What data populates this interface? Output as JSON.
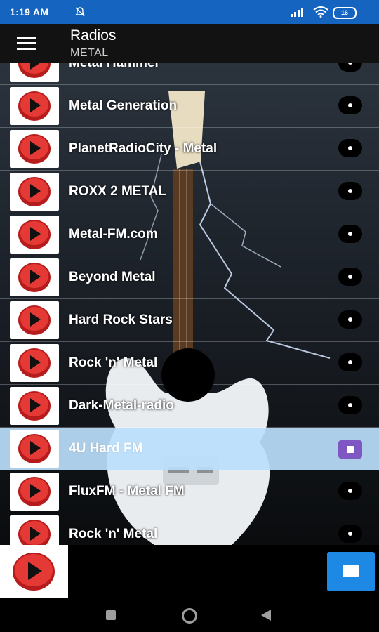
{
  "status_bar": {
    "time": "1:19 AM",
    "battery": "16"
  },
  "app_bar": {
    "title": "Radios",
    "subtitle": "METAL"
  },
  "stations": [
    {
      "name": "Metal Hammer",
      "action": "more"
    },
    {
      "name": "Metal Generation",
      "action": "more"
    },
    {
      "name": "PlanetRadioCity - Metal",
      "action": "more"
    },
    {
      "name": "ROXX 2 METAL",
      "action": "more"
    },
    {
      "name": "Metal-FM.com",
      "action": "more"
    },
    {
      "name": "Beyond Metal",
      "action": "more"
    },
    {
      "name": "Hard Rock Stars",
      "action": "more"
    },
    {
      "name": "Rock 'n' Metal",
      "action": "more"
    },
    {
      "name": "Dark-Metal-radio",
      "action": "more"
    },
    {
      "name": "4U Hard FM",
      "action": "playing"
    },
    {
      "name": "FluxFM - Metal FM",
      "action": "more"
    },
    {
      "name": "Rock 'n' Metal",
      "action": "more"
    }
  ],
  "selected_index": 9,
  "colors": {
    "status_bar": "#1565c0",
    "selected_row": "#bbdefb",
    "play_accent": "#7e57c2",
    "stop_button": "#1e88e5",
    "play_icon": "#d32f2f"
  },
  "icons": {
    "menu": "hamburger-icon",
    "play": "play-circle-icon",
    "stop": "stop-icon"
  }
}
